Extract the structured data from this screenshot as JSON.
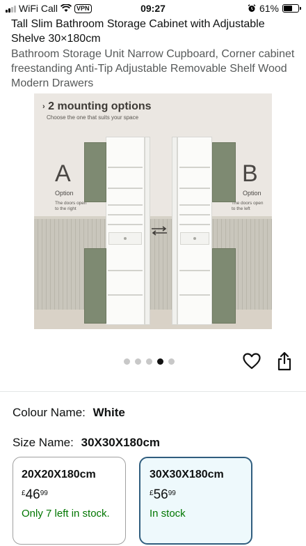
{
  "status_bar": {
    "carrier": "WiFi Call",
    "vpn": "VPN",
    "time": "09:27",
    "battery": "61%",
    "battery_level": 0.61
  },
  "product": {
    "title": "Tall Slim Bathroom Storage Cabinet with Adjustable Shelve 30×180cm",
    "subtitle": "Bathroom Storage Unit Narrow Cupboard, Corner cabinet freestanding Anti-Tip Adjustable Removable Shelf Wood Modern Drawers"
  },
  "image": {
    "heading": "2 mounting options",
    "subheading": "Choose the one that suits your space",
    "option_a": {
      "letter": "A",
      "word": "Option",
      "note_line1": "The doors open",
      "note_line2": "to the right"
    },
    "option_b": {
      "letter": "B",
      "word": "Option",
      "note_line1": "The doors open",
      "note_line2": "to the left"
    },
    "colors": {
      "door": "#7e8a72",
      "cabinet": "#fbfbf9",
      "wall": "#ebe7e2",
      "wainscot": "#c9c6bc"
    }
  },
  "carousel": {
    "total": 5,
    "active_index": 3
  },
  "actions": {
    "favorite_icon": "heart-icon",
    "share_icon": "share-icon"
  },
  "colour": {
    "label": "Colour Name:",
    "value": "White"
  },
  "size": {
    "label": "Size Name:",
    "value": "30X30X180cm"
  },
  "size_options": [
    {
      "size": "20X20X180cm",
      "currency": "£",
      "whole": "46",
      "fraction": "99",
      "stock": "Only 7 left in stock.",
      "selected": false
    },
    {
      "size": "30X30X180cm",
      "currency": "£",
      "whole": "56",
      "fraction": "99",
      "stock": "In stock",
      "selected": true
    }
  ],
  "accent": {
    "selected_border": "#2f5d7e",
    "selected_bg": "#eef9fc",
    "stock_green": "#007600"
  }
}
